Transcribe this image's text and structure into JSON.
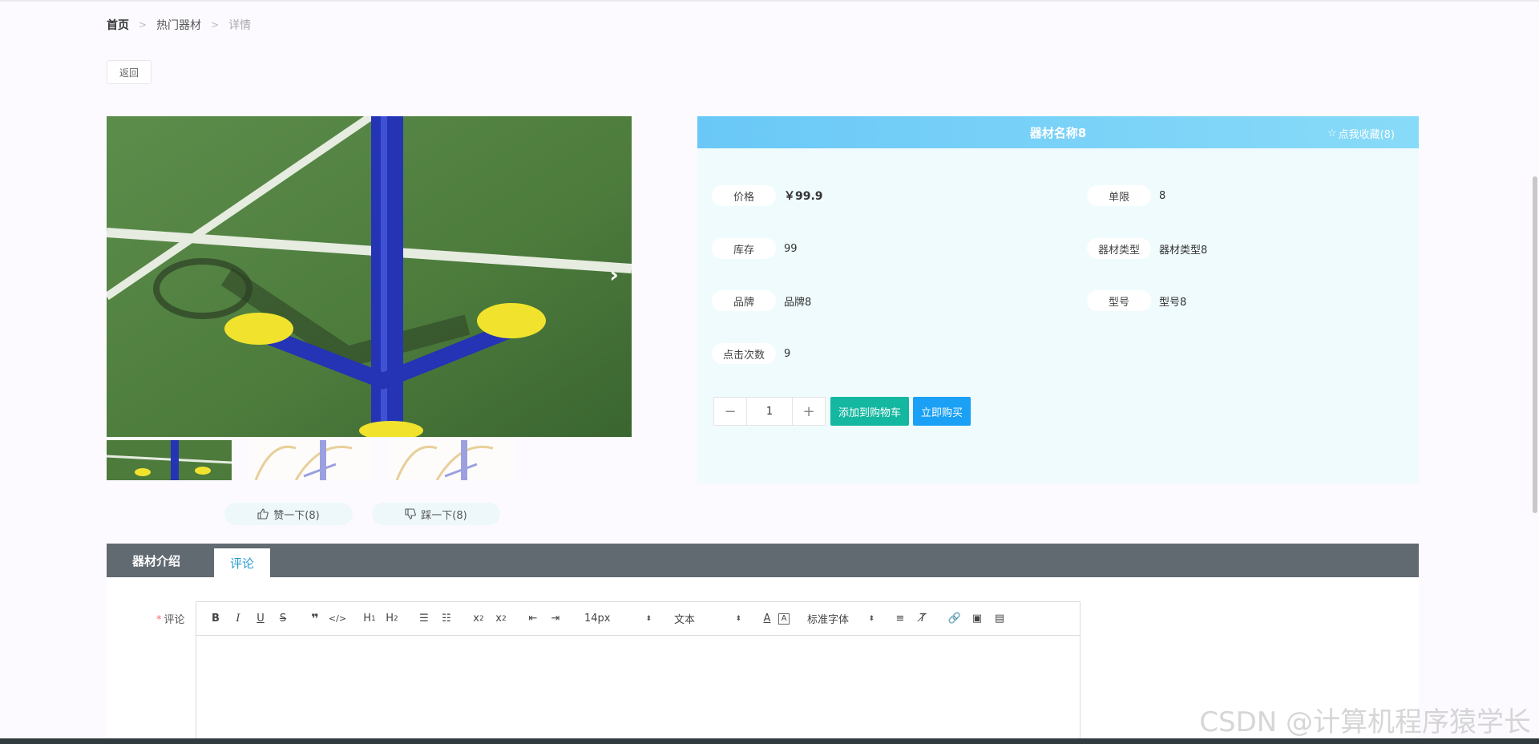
{
  "breadcrumb": {
    "home": "首页",
    "category": "热门器材",
    "current": "详情",
    "separator": ">"
  },
  "back_label": "返回",
  "product": {
    "name": "器材名称8",
    "favorite_label": "点我收藏(8)",
    "fields": [
      {
        "label": "价格",
        "value": "￥99.9"
      },
      {
        "label": "单限",
        "value": "8"
      },
      {
        "label": "库存",
        "value": "99"
      },
      {
        "label": "器材类型",
        "value": "器材类型8"
      },
      {
        "label": "品牌",
        "value": "品牌8"
      },
      {
        "label": "型号",
        "value": "型号8"
      },
      {
        "label": "点击次数",
        "value": "9"
      }
    ],
    "quantity": "1",
    "add_to_cart_label": "添加到购物车",
    "buy_now_label": "立即购买"
  },
  "votes": {
    "like_label": "赞一下(8)",
    "dislike_label": "踩一下(8)"
  },
  "tabs": [
    {
      "label": "器材介绍"
    },
    {
      "label": "评论"
    }
  ],
  "comment": {
    "label": "评论",
    "required_mark": "*",
    "font_size": "14px",
    "text_type": "文本",
    "font_family": "标准字体"
  },
  "watermark": "CSDN @计算机程序猿学长",
  "colors": {
    "header_gradient_start": "#6ac8f7",
    "cart": "#14b7a0",
    "buy": "#1aa0f5",
    "tabbar": "#616971"
  }
}
